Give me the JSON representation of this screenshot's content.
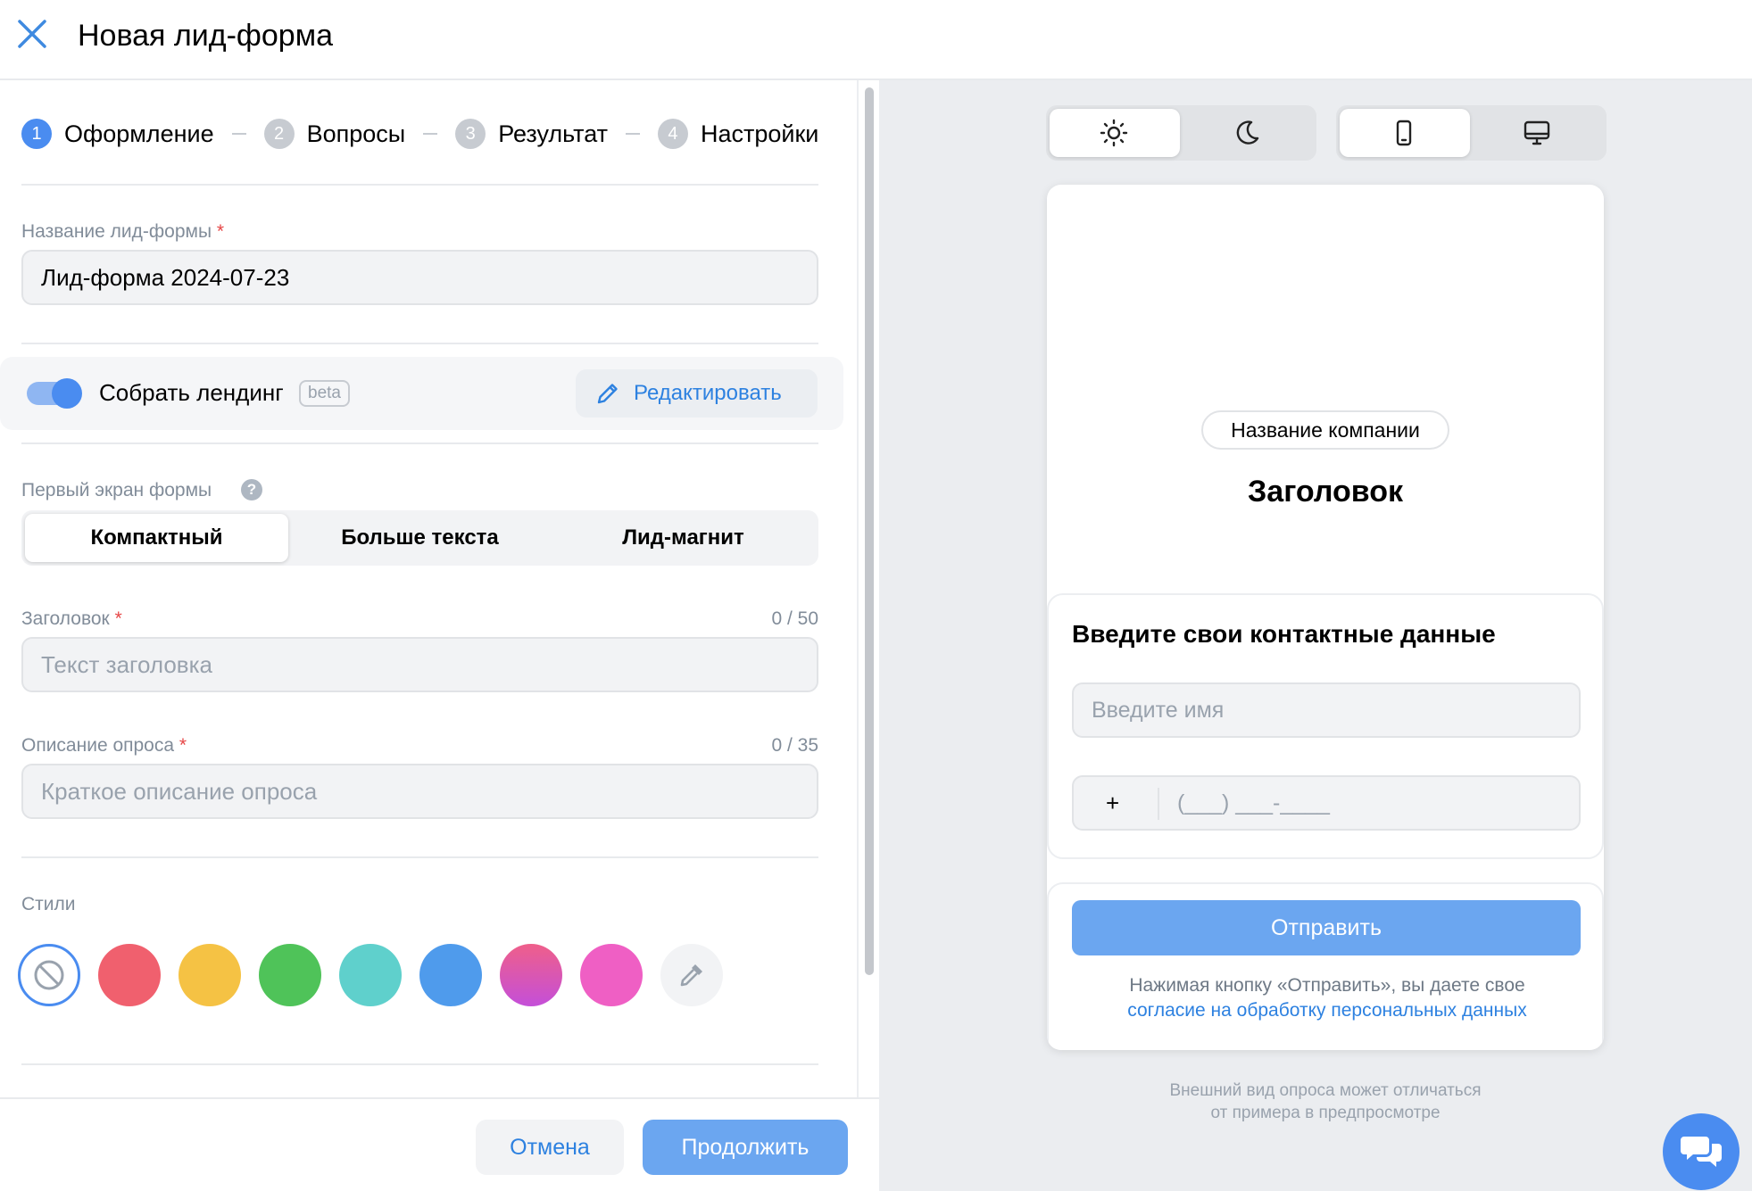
{
  "header": {
    "title": "Новая лид-форма"
  },
  "stepper": {
    "steps": [
      {
        "num": "1",
        "label": "Оформление"
      },
      {
        "num": "2",
        "label": "Вопросы"
      },
      {
        "num": "3",
        "label": "Результат"
      },
      {
        "num": "4",
        "label": "Настройки"
      }
    ],
    "active_step": 1
  },
  "form": {
    "name": {
      "label": "Название лид-формы",
      "required_mark": "*",
      "value": "Лид-форма 2024-07-23"
    },
    "landing": {
      "label": "Собрать лендинг",
      "badge": "beta",
      "enabled": true,
      "edit_label": "Редактировать"
    },
    "first_screen": {
      "label": "Первый экран формы",
      "help_glyph": "?",
      "options": [
        "Компактный",
        "Больше текста",
        "Лид-магнит"
      ],
      "selected": "Компактный"
    },
    "heading": {
      "label": "Заголовок",
      "required_mark": "*",
      "counter": "0 / 50",
      "placeholder": "Текст заголовка"
    },
    "description": {
      "label": "Описание опроса",
      "required_mark": "*",
      "counter": "0 / 35",
      "placeholder": "Краткое описание опроса"
    },
    "styles": {
      "label": "Стили",
      "swatches": [
        {
          "name": "none",
          "color": "#ffffff"
        },
        {
          "name": "red",
          "color": "#f0606e"
        },
        {
          "name": "yellow",
          "color": "#f5c244"
        },
        {
          "name": "green",
          "color": "#4fc359"
        },
        {
          "name": "teal",
          "color": "#5fd0cc"
        },
        {
          "name": "blue",
          "color": "#4f9bec"
        },
        {
          "name": "magenta",
          "color": "#c44fd9"
        },
        {
          "name": "pink",
          "color": "#ef5fc4"
        },
        {
          "name": "picker",
          "color": "#f2f3f5"
        }
      ]
    }
  },
  "footer": {
    "cancel_label": "Отмена",
    "continue_label": "Продолжить"
  },
  "preview": {
    "theme_options": [
      "sun-icon",
      "moon-icon"
    ],
    "theme_selected": "sun-icon",
    "device_options": [
      "phone-icon",
      "desktop-icon"
    ],
    "device_selected": "phone-icon",
    "company_name": "Название компании",
    "title": "Заголовок",
    "contact_title": "Введите свои контактные данные",
    "name_placeholder": "Введите имя",
    "phone_prefix": "+",
    "phone_mask": "(___) ___-____",
    "submit_label": "Отправить",
    "consent_text": "Нажимая кнопку «Отправить», вы даете свое",
    "consent_link": "согласие на обработку персональных данных",
    "note_line1": "Внешний вид опроса может отличаться",
    "note_line2": "от примера в предпросмотре"
  },
  "colors": {
    "accent": "#4a8cf0",
    "link": "#2d81e0",
    "muted": "#818c99",
    "required": "#e64646"
  }
}
